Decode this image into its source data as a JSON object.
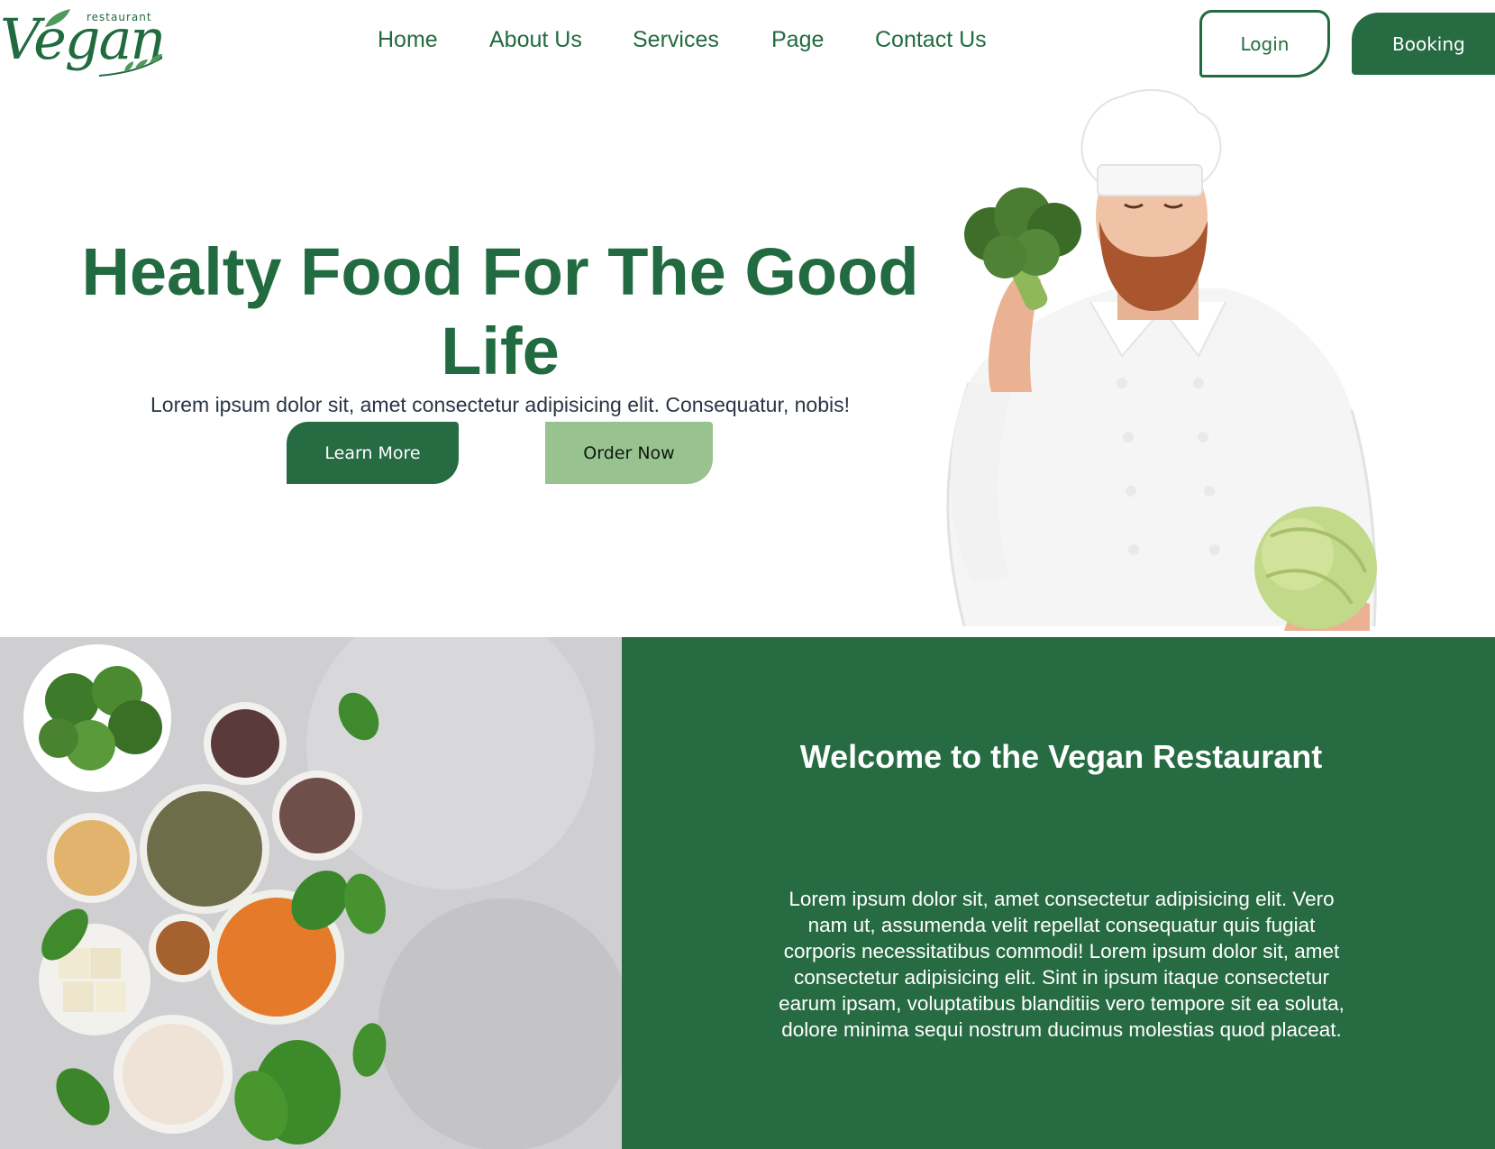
{
  "logo": {
    "small_text": "restaurant",
    "script_text": "Vegan"
  },
  "nav": {
    "links": [
      {
        "label": "Home"
      },
      {
        "label": "About Us"
      },
      {
        "label": "Services"
      },
      {
        "label": "Page"
      },
      {
        "label": "Contact Us"
      }
    ]
  },
  "header": {
    "login_label": "Login",
    "booking_label": "Booking"
  },
  "hero": {
    "title": "Healty Food For The Good Life",
    "subtitle": "Lorem ipsum dolor sit, amet consectetur adipisicing elit. Consequatur, nobis!",
    "learn_more_label": "Learn More",
    "order_now_label": "Order Now"
  },
  "welcome": {
    "title": "Welcome to the Vegan Restaurant",
    "body": "Lorem ipsum dolor sit, amet consectetur adipisicing elit. Vero nam ut, assumenda velit repellat consequatur quis fugiat corporis necessitatibus commodi! Lorem ipsum dolor sit, amet consectetur adipisicing elit. Sint in ipsum itaque consectetur earum ipsam, voluptatibus blanditiis vero tempore sit ea soluta, dolore minima sequi nostrum ducimus molestias quod placeat."
  },
  "colors": {
    "brand_green": "#276b43",
    "text_green": "#226b40",
    "light_green": "#98c28f",
    "body_text": "#2a3645"
  }
}
